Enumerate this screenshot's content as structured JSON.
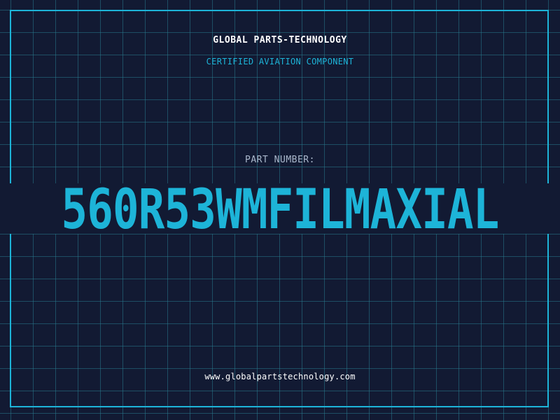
{
  "header": {
    "brand": "GLOBAL PARTS-TECHNOLOGY",
    "subtitle": "CERTIFIED AVIATION COMPONENT"
  },
  "part": {
    "label": "PART NUMBER:",
    "number": "560R53WMFILMAXIAL"
  },
  "footer": {
    "website": "www.globalpartstechnology.com"
  },
  "colors": {
    "background": "#121a33",
    "accent": "#1db4d8",
    "grid": "#28788c",
    "text": "#ffffff",
    "muted": "#aab8cc"
  }
}
